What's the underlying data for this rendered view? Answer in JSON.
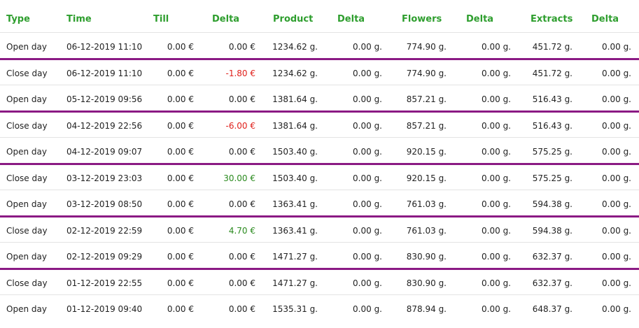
{
  "headers": {
    "type": "Type",
    "time": "Time",
    "till": "Till",
    "delta_till": "Delta",
    "product": "Product",
    "delta_product": "Delta",
    "flowers": "Flowers",
    "delta_flowers": "Delta",
    "extracts": "Extracts",
    "delta_extracts": "Delta"
  },
  "colors": {
    "header_green": "#2e9e2e",
    "separator_purple": "#8b1a84",
    "negative_red": "#e0201b",
    "positive_green": "#2a8a1e"
  },
  "rows": [
    {
      "type": "Open day",
      "time": "06-12-2019 11:10",
      "till": "0.00 €",
      "delta_till": "0.00 €",
      "delta_sign": "zero",
      "product": "1234.62 g.",
      "delta_product": "0.00 g.",
      "flowers": "774.90 g.",
      "delta_flowers": "0.00 g.",
      "extracts": "451.72 g.",
      "delta_extracts": "0.00 g."
    },
    {
      "type": "Close day",
      "time": "06-12-2019 11:10",
      "till": "0.00 €",
      "delta_till": "-1.80 €",
      "delta_sign": "negative",
      "product": "1234.62 g.",
      "delta_product": "0.00 g.",
      "flowers": "774.90 g.",
      "delta_flowers": "0.00 g.",
      "extracts": "451.72 g.",
      "delta_extracts": "0.00 g."
    },
    {
      "type": "Open day",
      "time": "05-12-2019 09:56",
      "till": "0.00 €",
      "delta_till": "0.00 €",
      "delta_sign": "zero",
      "product": "1381.64 g.",
      "delta_product": "0.00 g.",
      "flowers": "857.21 g.",
      "delta_flowers": "0.00 g.",
      "extracts": "516.43 g.",
      "delta_extracts": "0.00 g."
    },
    {
      "type": "Close day",
      "time": "04-12-2019 22:56",
      "till": "0.00 €",
      "delta_till": "-6.00 €",
      "delta_sign": "negative",
      "product": "1381.64 g.",
      "delta_product": "0.00 g.",
      "flowers": "857.21 g.",
      "delta_flowers": "0.00 g.",
      "extracts": "516.43 g.",
      "delta_extracts": "0.00 g."
    },
    {
      "type": "Open day",
      "time": "04-12-2019 09:07",
      "till": "0.00 €",
      "delta_till": "0.00 €",
      "delta_sign": "zero",
      "product": "1503.40 g.",
      "delta_product": "0.00 g.",
      "flowers": "920.15 g.",
      "delta_flowers": "0.00 g.",
      "extracts": "575.25 g.",
      "delta_extracts": "0.00 g."
    },
    {
      "type": "Close day",
      "time": "03-12-2019 23:03",
      "till": "0.00 €",
      "delta_till": "30.00 €",
      "delta_sign": "positive",
      "product": "1503.40 g.",
      "delta_product": "0.00 g.",
      "flowers": "920.15 g.",
      "delta_flowers": "0.00 g.",
      "extracts": "575.25 g.",
      "delta_extracts": "0.00 g."
    },
    {
      "type": "Open day",
      "time": "03-12-2019 08:50",
      "till": "0.00 €",
      "delta_till": "0.00 €",
      "delta_sign": "zero",
      "product": "1363.41 g.",
      "delta_product": "0.00 g.",
      "flowers": "761.03 g.",
      "delta_flowers": "0.00 g.",
      "extracts": "594.38 g.",
      "delta_extracts": "0.00 g."
    },
    {
      "type": "Close day",
      "time": "02-12-2019 22:59",
      "till": "0.00 €",
      "delta_till": "4.70 €",
      "delta_sign": "positive",
      "product": "1363.41 g.",
      "delta_product": "0.00 g.",
      "flowers": "761.03 g.",
      "delta_flowers": "0.00 g.",
      "extracts": "594.38 g.",
      "delta_extracts": "0.00 g."
    },
    {
      "type": "Open day",
      "time": "02-12-2019 09:29",
      "till": "0.00 €",
      "delta_till": "0.00 €",
      "delta_sign": "zero",
      "product": "1471.27 g.",
      "delta_product": "0.00 g.",
      "flowers": "830.90 g.",
      "delta_flowers": "0.00 g.",
      "extracts": "632.37 g.",
      "delta_extracts": "0.00 g."
    },
    {
      "type": "Close day",
      "time": "01-12-2019 22:55",
      "till": "0.00 €",
      "delta_till": "0.00 €",
      "delta_sign": "zero",
      "product": "1471.27 g.",
      "delta_product": "0.00 g.",
      "flowers": "830.90 g.",
      "delta_flowers": "0.00 g.",
      "extracts": "632.37 g.",
      "delta_extracts": "0.00 g."
    },
    {
      "type": "Open day",
      "time": "01-12-2019 09:40",
      "till": "0.00 €",
      "delta_till": "0.00 €",
      "delta_sign": "zero",
      "product": "1535.31 g.",
      "delta_product": "0.00 g.",
      "flowers": "878.94 g.",
      "delta_flowers": "0.00 g.",
      "extracts": "648.37 g.",
      "delta_extracts": "0.00 g."
    }
  ]
}
